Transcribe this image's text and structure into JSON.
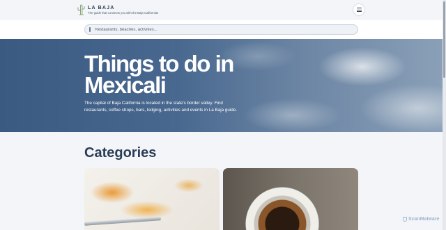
{
  "header": {
    "brand": "LA BAJA",
    "tagline": "The guide that connects you with the Baja Californias",
    "logo_icon": "cactus-icon",
    "menu_icon": "hamburger-menu-icon"
  },
  "search": {
    "placeholder": "Restaurants, beaches, activities..."
  },
  "hero": {
    "title": "Things to do in Mexicali",
    "description": "The capital of Baja California is located in the state's border valley. Find restaurants, coffee shops, bars, lodging, activities and events in La Baja guide."
  },
  "categories": {
    "title": "Categories"
  },
  "watermark": {
    "text": "ScanMalware"
  },
  "colors": {
    "primary_text": "#2b3d55",
    "background": "#f3f5f8",
    "hero_overlay": "#3b5a82"
  }
}
